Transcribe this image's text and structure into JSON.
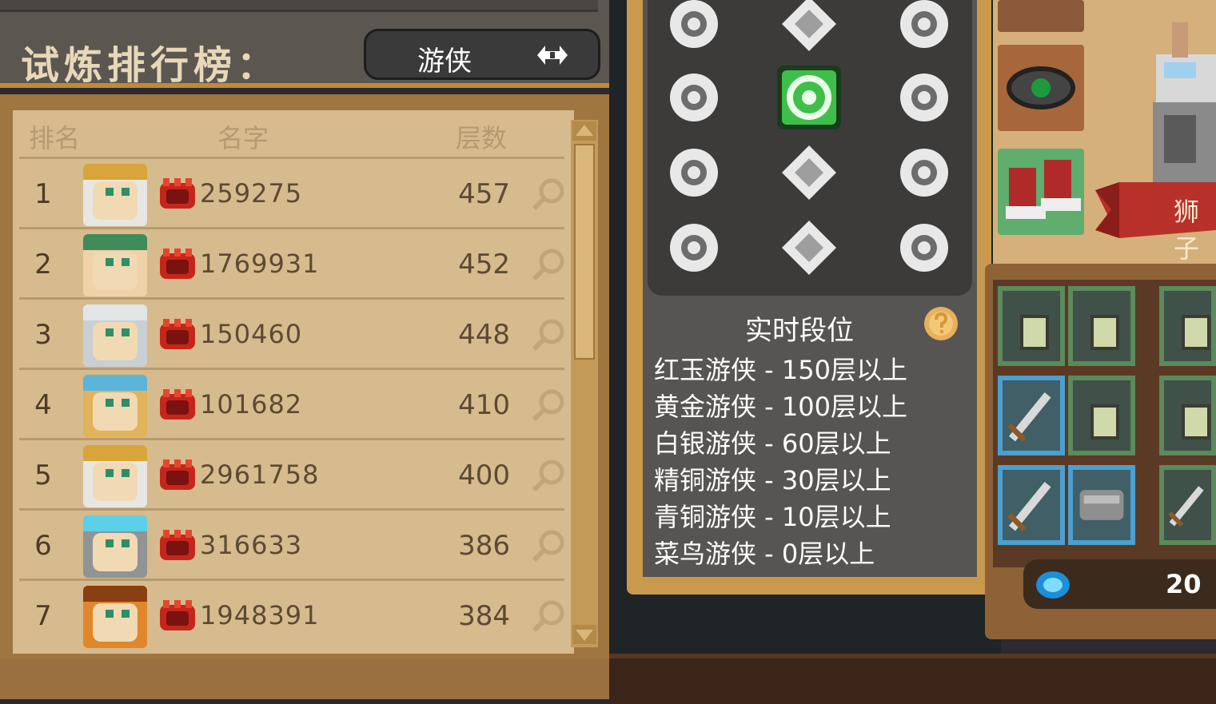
{
  "leaderboard": {
    "title": "试炼排行榜：",
    "selected_class": "游侠",
    "columns": {
      "rank": "排名",
      "name": "名字",
      "floors": "层数"
    },
    "rows": [
      {
        "rank": "1",
        "player": "259275",
        "floors": "457",
        "avatar": "white-hair-gold-crown"
      },
      {
        "rank": "2",
        "player": "1769931",
        "floors": "452",
        "avatar": "bald-green-scarf"
      },
      {
        "rank": "3",
        "player": "150460",
        "floors": "448",
        "avatar": "silver-hair"
      },
      {
        "rank": "4",
        "player": "101682",
        "floors": "410",
        "avatar": "goggles-blonde"
      },
      {
        "rank": "5",
        "player": "2961758",
        "floors": "400",
        "avatar": "white-hair-gold-crown"
      },
      {
        "rank": "6",
        "player": "316633",
        "floors": "386",
        "avatar": "steel-helmet"
      },
      {
        "rank": "7",
        "player": "1948391",
        "floors": "384",
        "avatar": "orange-beast"
      }
    ]
  },
  "rank_info": {
    "heading": "实时段位",
    "tiers": [
      "红玉游侠 - 150层以上",
      "黄金游侠 - 100层以上",
      "白银游侠 - 60层以上",
      "精铜游侠 - 30层以上",
      "青铜游侠 - 10层以上",
      "菜鸟游侠 - 0层以上"
    ],
    "badges": [
      "beetle-badge-icon",
      "diamond-badge-icon",
      "helmet-badge-icon",
      "tower-badge-icon",
      "green-swirl-badge-icon",
      "crossed-swords-badge-icon",
      "hexagon-badge-icon",
      "star-diamond-badge-icon",
      "flame-badge-icon",
      "winged-shield-badge-icon",
      "spiral-badge-icon",
      "vortex-badge-icon"
    ],
    "selected_badge_color": "#3fbf4a"
  },
  "side_panel": {
    "banner_label": "狮子",
    "gem_count": "20"
  },
  "colors": {
    "panel_wood": "#c08a3a",
    "table_bg": "#d6bb8e",
    "popup_bg": "#575553"
  }
}
